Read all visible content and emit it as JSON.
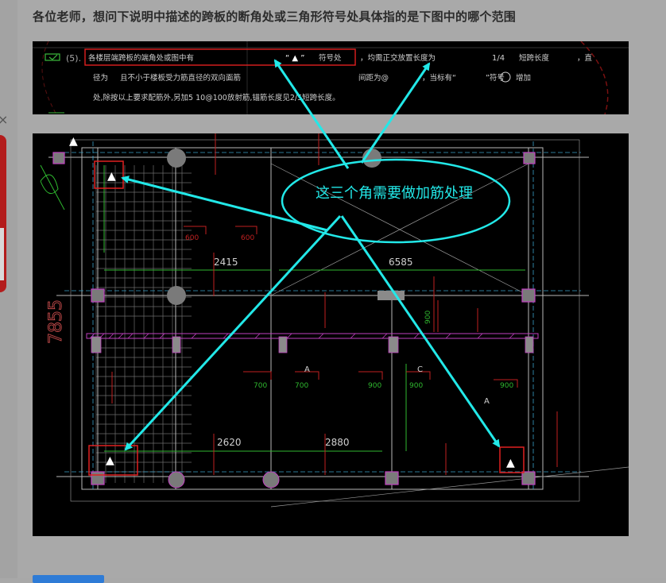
{
  "question": {
    "title": "各位老师，想问下说明中描述的跨板的断角处或三角形符号处具体指的是下图中的哪个范围"
  },
  "image1": {
    "item_number": "(5).",
    "line1_text": "各楼层端跨板的端角处或图中有",
    "line1_symbol": "“ ▲ ”",
    "line1_suffix": "符号处",
    "line1_rest": "，均需正交放置长度为",
    "line1_fraction": "1/4",
    "line1_tail": "短跨长度",
    "line1_end": "，直",
    "line2_text": "径为",
    "line2_more": "且不小于楼板受力筋直径的双向面筋",
    "line2_spacing": "间距为@",
    "line2_when": "，当标有“",
    "line2_symbol2": "”符号",
    "line2_end": "增加",
    "line3_text": "处,除按以上要求配筋外,另加5  10@100放射筋,锚筋长度见2/5短跨长度。"
  },
  "image2": {
    "annotation_text": "这三个角需要做加筋处理",
    "dim_vertical": "7855",
    "dim_2415": "2415",
    "dim_6585": "6585",
    "dim_2620": "2620",
    "dim_2880": "2880",
    "labels_600": [
      "600",
      "600"
    ],
    "labels_700": [
      "700",
      "700"
    ],
    "labels_900": [
      "900",
      "900",
      "900",
      "900"
    ],
    "label_A": "A",
    "label_C": "C",
    "triangle": "▲"
  },
  "side": {
    "close_glyph": "×"
  },
  "colors": {
    "annotation": "#22e8e8",
    "highlight_box": "#e02020",
    "cad_grid": "#9a9a9a",
    "cad_green": "#2fb82f",
    "cad_magenta": "#c040c0",
    "cad_red": "#c02020"
  }
}
